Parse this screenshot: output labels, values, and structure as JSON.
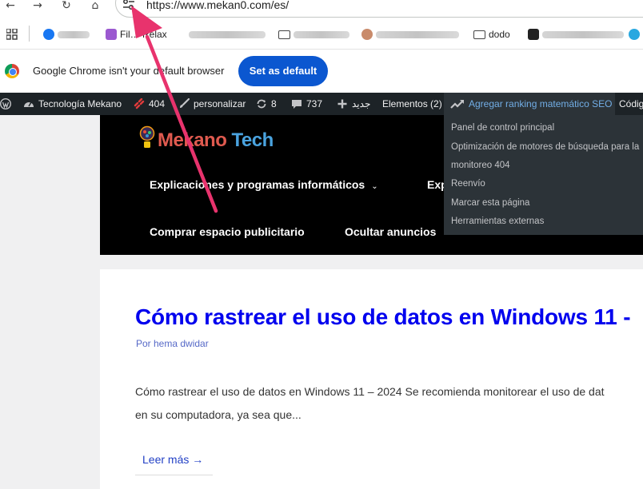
{
  "browser": {
    "url": "https://www.mekan0.com/es/",
    "bookmarks": [
      {
        "label": "",
        "icon": "bookmark-favicon"
      },
      {
        "label": "Fil… Relax",
        "icon": "bookmark-favicon"
      },
      {
        "label": "",
        "icon": "bookmark-favicon"
      },
      {
        "label": "",
        "icon": "folder-icon"
      },
      {
        "label": "",
        "icon": "bookmark-favicon"
      },
      {
        "label": "dodo",
        "icon": "folder-icon"
      },
      {
        "label": "",
        "icon": "bookmark-favicon"
      }
    ],
    "infobar": {
      "message": "Google Chrome isn't your default browser",
      "button": "Set as default"
    }
  },
  "adminbar": {
    "site_name": "Tecnología Mekano",
    "broken_links": "404",
    "customize": "personalizar",
    "updates": "8",
    "comments": "737",
    "new": "جديد",
    "elements": "Elementos (2)",
    "seo": "Agregar ranking matemático SEO",
    "code": "Códig"
  },
  "seo_menu": [
    "Panel de control principal",
    "Optimización de motores de búsqueda para la",
    "monitoreo 404",
    "Reenvío",
    "Marcar esta página",
    "Herramientas externas"
  ],
  "site": {
    "logo_part1": "Mekano",
    "logo_part2": "Tech",
    "menu": [
      "Explicaciones y programas informáticos",
      "Exp",
      "Comprar espacio publicitario",
      "Ocultar anuncios"
    ]
  },
  "post": {
    "title": "Cómo rastrear el uso de datos en Windows 11 -",
    "author": "Por hema dwidar",
    "excerpt_line1": "Cómo rastrear el uso de datos en Windows 11 – 2024 Se recomienda monitorear el uso de dat",
    "excerpt_line2": "en su computadora, ya sea que...",
    "read_more": "Leer más →"
  },
  "colors": {
    "adminbar": "#1d2327",
    "chrome_blue": "#0b57d0",
    "post_title": "#0000ee",
    "annotation_arrow": "#e8336d"
  }
}
